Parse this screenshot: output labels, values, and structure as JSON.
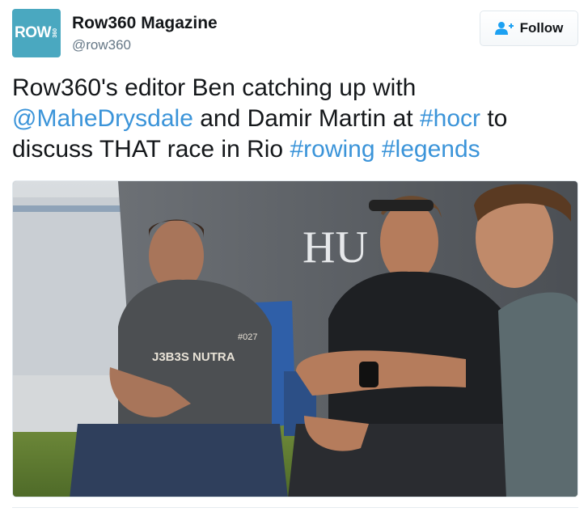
{
  "author": {
    "name": "Row360 Magazine",
    "handle": "@row360",
    "avatar": {
      "logo_text": "ROW",
      "logo_sub": "360",
      "color": "#4aa8c0"
    }
  },
  "follow_button": {
    "label": "Follow",
    "icon": "follow-user-icon"
  },
  "tweet": {
    "segments": [
      {
        "text": "Row360's editor Ben catching up with ",
        "type": "text"
      },
      {
        "text": "@MaheDrysdale",
        "type": "mention"
      },
      {
        "text": " and Damir Martin at ",
        "type": "text"
      },
      {
        "text": "#hocr",
        "type": "hashtag"
      },
      {
        "text": " to discuss THAT race in Rio ",
        "type": "text"
      },
      {
        "text": "#rowing",
        "type": "hashtag"
      },
      {
        "text": " ",
        "type": "text"
      },
      {
        "text": "#legends",
        "type": "hashtag"
      }
    ],
    "link_color": "#3b94d9"
  },
  "photo": {
    "tent_text": "HU",
    "shirt_left_text": "J3B3S NUTRA",
    "shirt_left_number": "#027"
  }
}
